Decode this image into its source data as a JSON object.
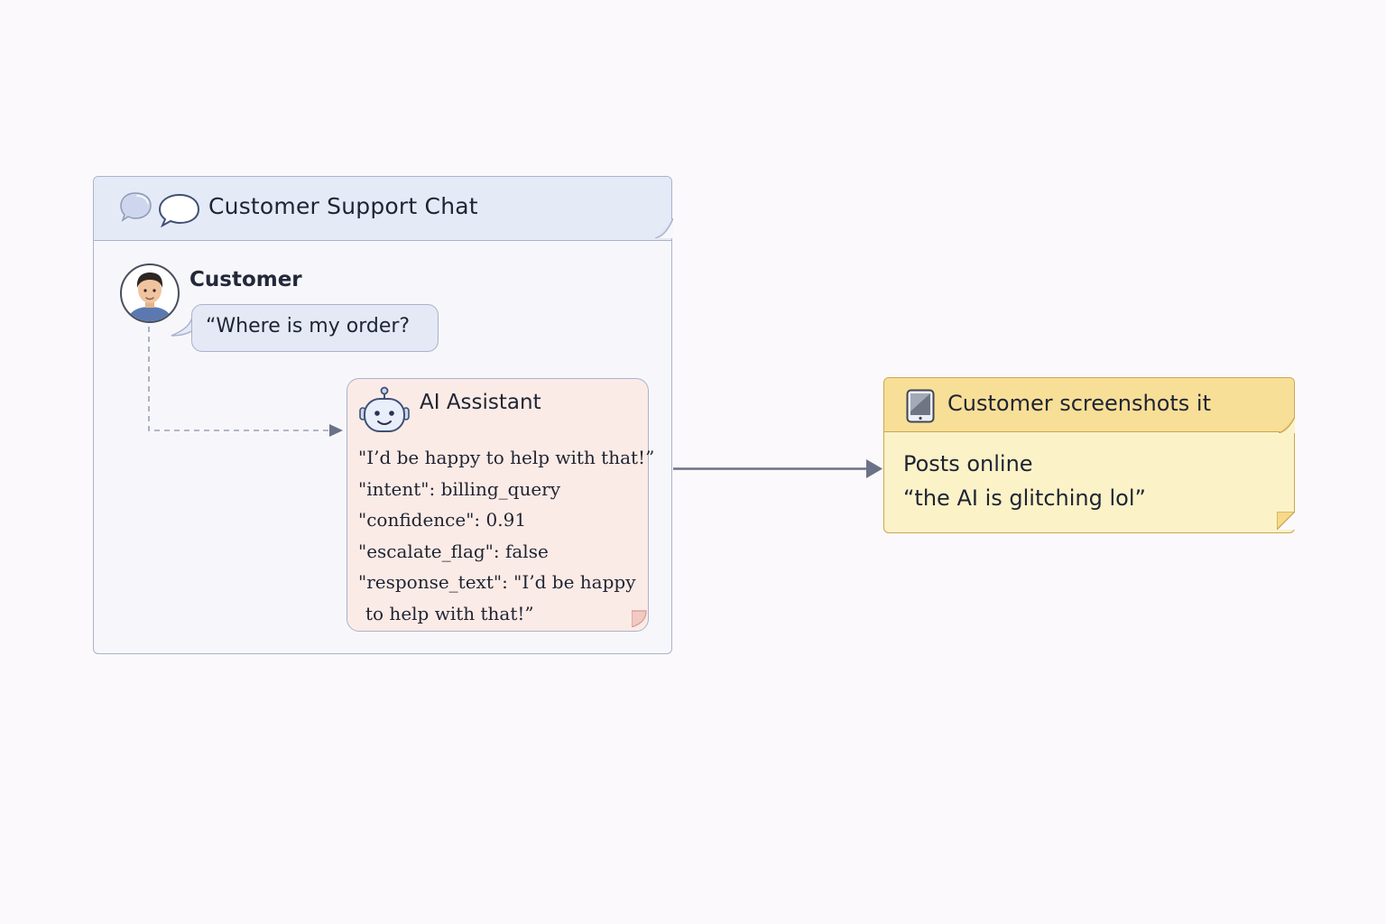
{
  "chat_window": {
    "title": "Customer Support Chat",
    "icons": [
      "speech-bubble-filled-icon",
      "speech-bubble-outline-icon"
    ]
  },
  "customer": {
    "name": "Customer",
    "message": "“Where is my order?",
    "icon": "customer-avatar-icon"
  },
  "ai_assistant": {
    "title": "AI Assistant",
    "icon": "robot-icon",
    "lines": [
      "\"I’d be happy to help with that!”",
      "\"intent\": billing_query",
      "\"confidence\": 0.91",
      "\"escalate_flag\": false",
      "\"response_text\": \"I’d be happy",
      "to help with that!”"
    ]
  },
  "outcome": {
    "title": "Customer screenshots it",
    "icon": "tablet-icon",
    "line1": "Posts online",
    "line2": "“the AI is glitching lol”"
  },
  "colors": {
    "background": "#fbf9fb",
    "chat_header": "#e5eaf7",
    "chat_border": "#a9b3cc",
    "ai_card": "#fbebe6",
    "note_header": "#f8df97",
    "note_body": "#fcf2c8",
    "note_border": "#c9a752",
    "arrow": "#6b7186"
  }
}
